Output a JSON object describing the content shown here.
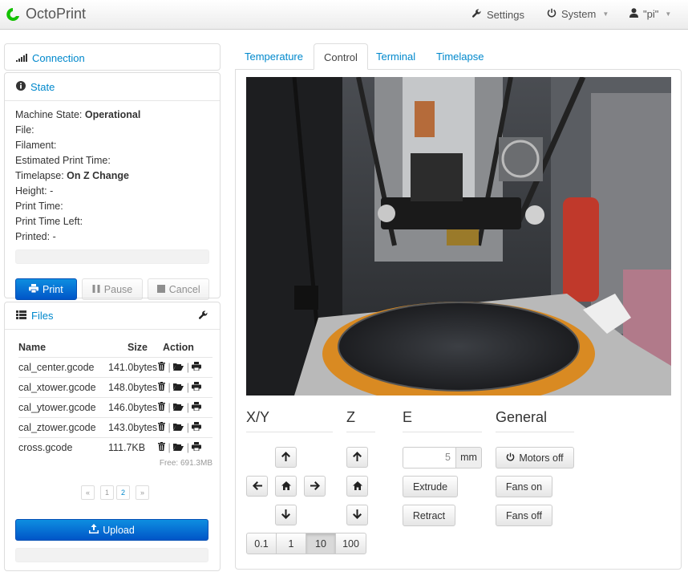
{
  "navbar": {
    "brand": "OctoPrint",
    "settings": "Settings",
    "system": "System",
    "user": "\"pi\""
  },
  "connection": {
    "title": "Connection"
  },
  "state": {
    "title": "State",
    "machine_state_label": "Machine State:",
    "machine_state_value": "Operational",
    "file_label": "File:",
    "filament_label": "Filament:",
    "est_time_label": "Estimated Print Time:",
    "timelapse_label": "Timelapse:",
    "timelapse_value": "On Z Change",
    "height_label": "Height:",
    "height_value": "-",
    "print_time_label": "Print Time:",
    "print_time_left_label": "Print Time Left:",
    "printed_label": "Printed:",
    "printed_value": "-",
    "progress": 0,
    "buttons": {
      "print": "Print",
      "pause": "Pause",
      "cancel": "Cancel"
    }
  },
  "files": {
    "title": "Files",
    "columns": {
      "name": "Name",
      "size": "Size",
      "action": "Action"
    },
    "rows": [
      {
        "name": "cal_center.gcode",
        "size": "141.0bytes"
      },
      {
        "name": "cal_xtower.gcode",
        "size": "148.0bytes"
      },
      {
        "name": "cal_ytower.gcode",
        "size": "146.0bytes"
      },
      {
        "name": "cal_ztower.gcode",
        "size": "143.0bytes"
      },
      {
        "name": "cross.gcode",
        "size": "111.7KB"
      }
    ],
    "free": "Free: 691.3MB",
    "pager": [
      "«",
      "1",
      "2",
      "»"
    ],
    "upload": "Upload"
  },
  "tabs": [
    "Temperature",
    "Control",
    "Terminal",
    "Timelapse"
  ],
  "control": {
    "xy_title": "X/Y",
    "z_title": "Z",
    "e_title": "E",
    "general_title": "General",
    "steps": [
      "0.1",
      "1",
      "10",
      "100"
    ],
    "active_step": "10",
    "extrude_amount": "5",
    "unit": "mm",
    "extrude": "Extrude",
    "retract": "Retract",
    "motors_off": "Motors off",
    "fans_on": "Fans on",
    "fans_off": "Fans off"
  }
}
